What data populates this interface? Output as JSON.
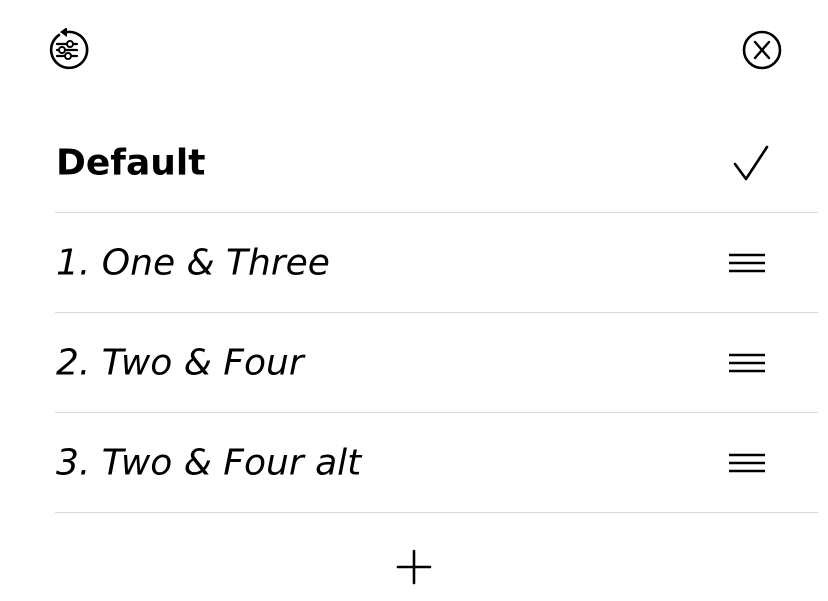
{
  "header": {
    "reset_icon": "reset-sliders-icon",
    "close_icon": "close-circle-icon"
  },
  "presets": [
    {
      "label": "Default",
      "selected": true
    },
    {
      "label": "1. One & Three",
      "selected": false
    },
    {
      "label": "2. Two & Four",
      "selected": false
    },
    {
      "label": "3. Two & Four alt",
      "selected": false
    }
  ],
  "footer": {
    "add_icon": "plus-icon"
  },
  "colors": {
    "text": "#000000",
    "divider": "#d9d9d9",
    "background": "#ffffff"
  }
}
